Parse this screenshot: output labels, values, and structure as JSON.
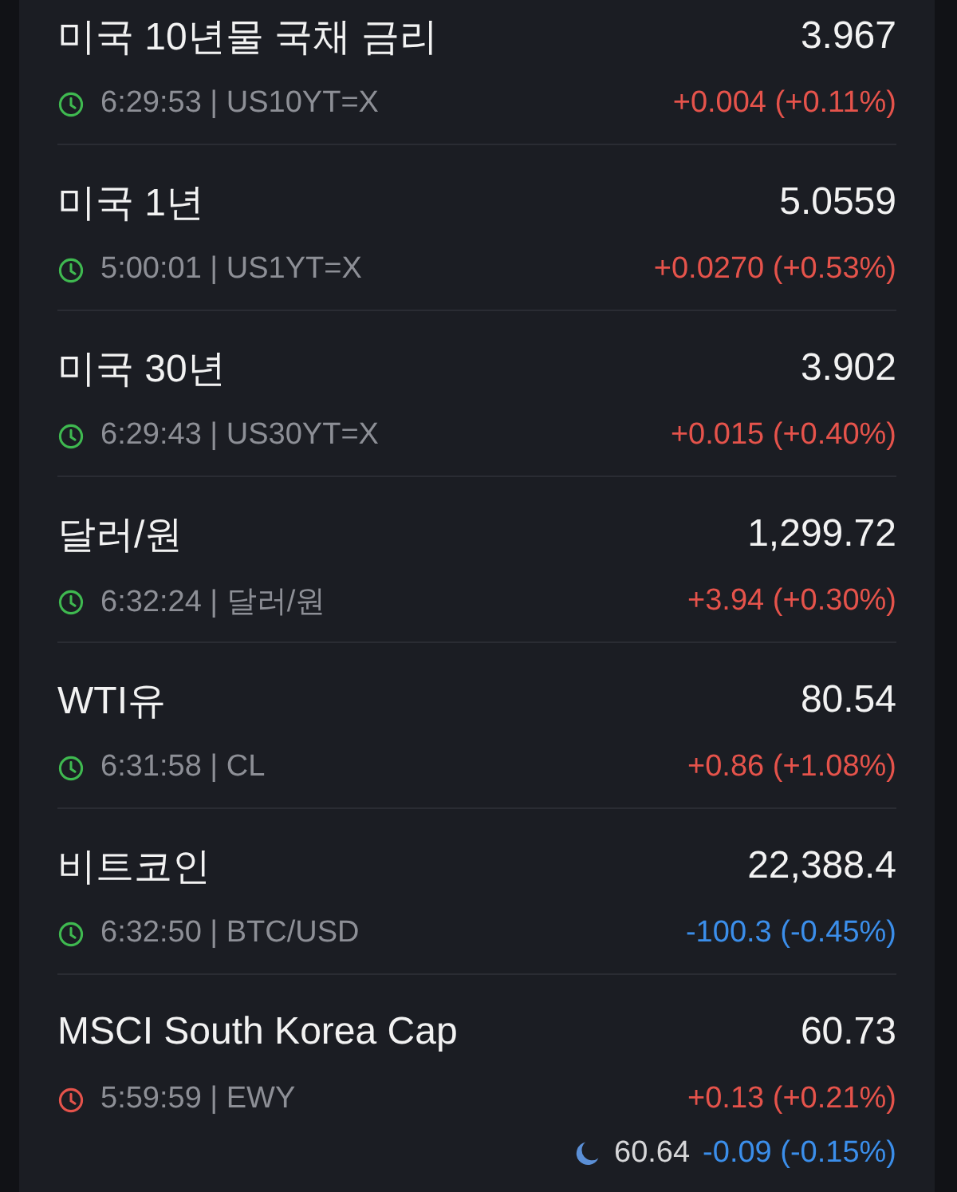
{
  "quotes": [
    {
      "name": "미국 10년물 국채 금리",
      "price": "3.967",
      "clock": {
        "color": "#3fb950"
      },
      "meta": "6:29:53 | US10YT=X",
      "change": {
        "text": "+0.004 (+0.11%)",
        "color": "#e5534b"
      }
    },
    {
      "name": "미국 1년",
      "price": "5.0559",
      "clock": {
        "color": "#3fb950"
      },
      "meta": "5:00:01 | US1YT=X",
      "change": {
        "text": "+0.0270 (+0.53%)",
        "color": "#e5534b"
      }
    },
    {
      "name": "미국 30년",
      "price": "3.902",
      "clock": {
        "color": "#3fb950"
      },
      "meta": "6:29:43 | US30YT=X",
      "change": {
        "text": "+0.015 (+0.40%)",
        "color": "#e5534b"
      }
    },
    {
      "name": "달러/원",
      "price": "1,299.72",
      "clock": {
        "color": "#3fb950"
      },
      "meta": "6:32:24 | 달러/원",
      "change": {
        "text": "+3.94 (+0.30%)",
        "color": "#e5534b"
      }
    },
    {
      "name": "WTI유",
      "price": "80.54",
      "clock": {
        "color": "#3fb950"
      },
      "meta": "6:31:58 | CL",
      "change": {
        "text": "+0.86 (+1.08%)",
        "color": "#e5534b"
      }
    },
    {
      "name": "비트코인",
      "price": "22,388.4",
      "clock": {
        "color": "#3fb950"
      },
      "meta": "6:32:50 | BTC/USD",
      "change": {
        "text": "-100.3 (-0.45%)",
        "color": "#3b8eea"
      }
    },
    {
      "name": "MSCI South Korea Cap",
      "price": "60.73",
      "clock": {
        "color": "#e5534b"
      },
      "meta": "5:59:59 | EWY",
      "change": {
        "text": "+0.13 (+0.21%)",
        "color": "#e5534b"
      },
      "after_hours": {
        "price": "60.64",
        "change": {
          "text": "-0.09 (-0.15%)",
          "color": "#3b8eea"
        }
      }
    }
  ]
}
